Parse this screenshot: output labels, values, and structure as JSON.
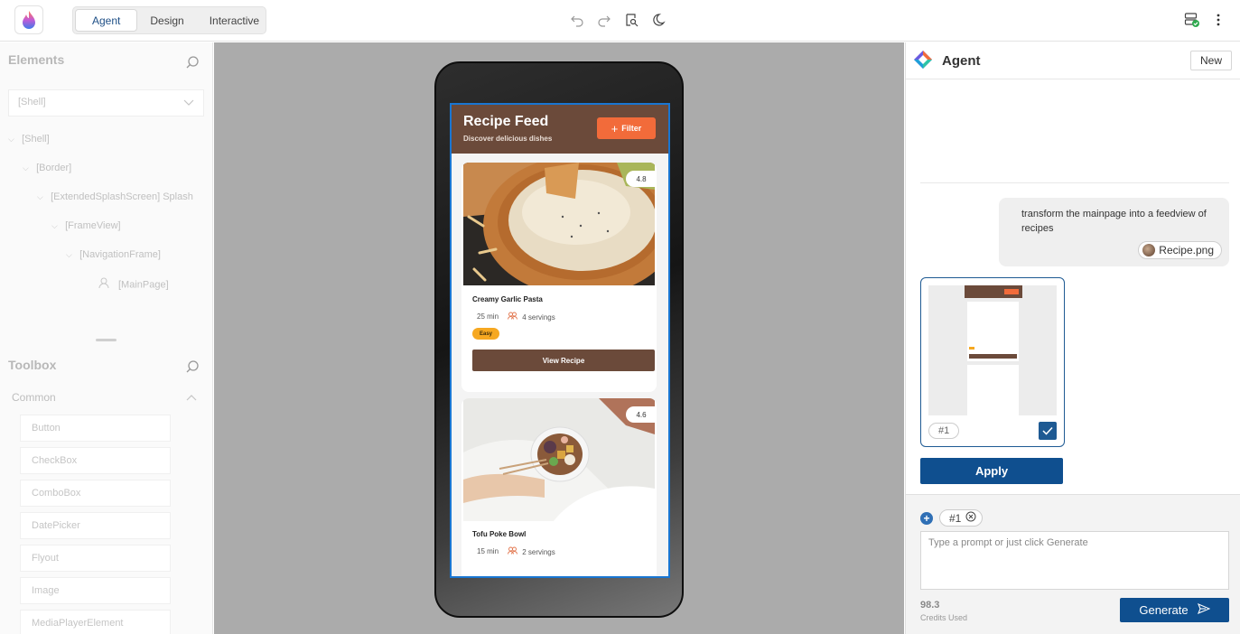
{
  "toolbar": {
    "tabs": [
      {
        "label": "Agent",
        "active": true
      },
      {
        "label": "Design",
        "active": false
      },
      {
        "label": "Interactive",
        "active": false
      }
    ],
    "tool_icons": [
      "undo-icon",
      "redo-icon",
      "inspect-icon",
      "theme-icon"
    ],
    "right_icons": [
      "server-status-icon",
      "more-vertical-icon"
    ]
  },
  "elements_panel": {
    "title": "Elements",
    "selector_value": "[Shell]",
    "tree": [
      {
        "label": "[Shell]",
        "level": 0
      },
      {
        "label": "[Border]",
        "level": 1
      },
      {
        "label": "[ExtendedSplashScreen] Splash",
        "level": 2
      },
      {
        "label": "[FrameView]",
        "level": 3
      },
      {
        "label": "[NavigationFrame]",
        "level": 4
      },
      {
        "label": "[MainPage]",
        "level": 5
      }
    ]
  },
  "toolbox": {
    "title": "Toolbox",
    "section": "Common",
    "items": [
      "Button",
      "CheckBox",
      "ComboBox",
      "DatePicker",
      "Flyout",
      "Image",
      "MediaPlayerElement"
    ]
  },
  "app": {
    "title": "Recipe Feed",
    "subtitle": "Discover delicious dishes",
    "filter_label": "Filter",
    "recipes": [
      {
        "name": "Creamy Garlic Pasta",
        "rating": "4.8",
        "time": "25 min",
        "servings": "4 servings",
        "difficulty": "Easy",
        "button": "View Recipe"
      },
      {
        "name": "Tofu Poke Bowl",
        "rating": "4.6",
        "time": "15 min",
        "servings": "2 servings"
      }
    ]
  },
  "agent": {
    "title": "Agent",
    "new_label": "New",
    "user_message": "transform the mainpage into a feedview of recipes",
    "attachment": "Recipe.png",
    "preview_tag": "#1",
    "apply_label": "Apply",
    "context_chip": "#1",
    "prompt_placeholder": "Type a prompt or just click Generate",
    "credits_value": "98.3",
    "credits_label": "Credits Used",
    "generate_label": "Generate"
  },
  "colors": {
    "accent": "#0f4f8f",
    "header_brown": "#6b4a3a",
    "filter_orange": "#f26b3a",
    "badge_yellow": "#f6a821",
    "selection_blue": "#1976d2"
  }
}
